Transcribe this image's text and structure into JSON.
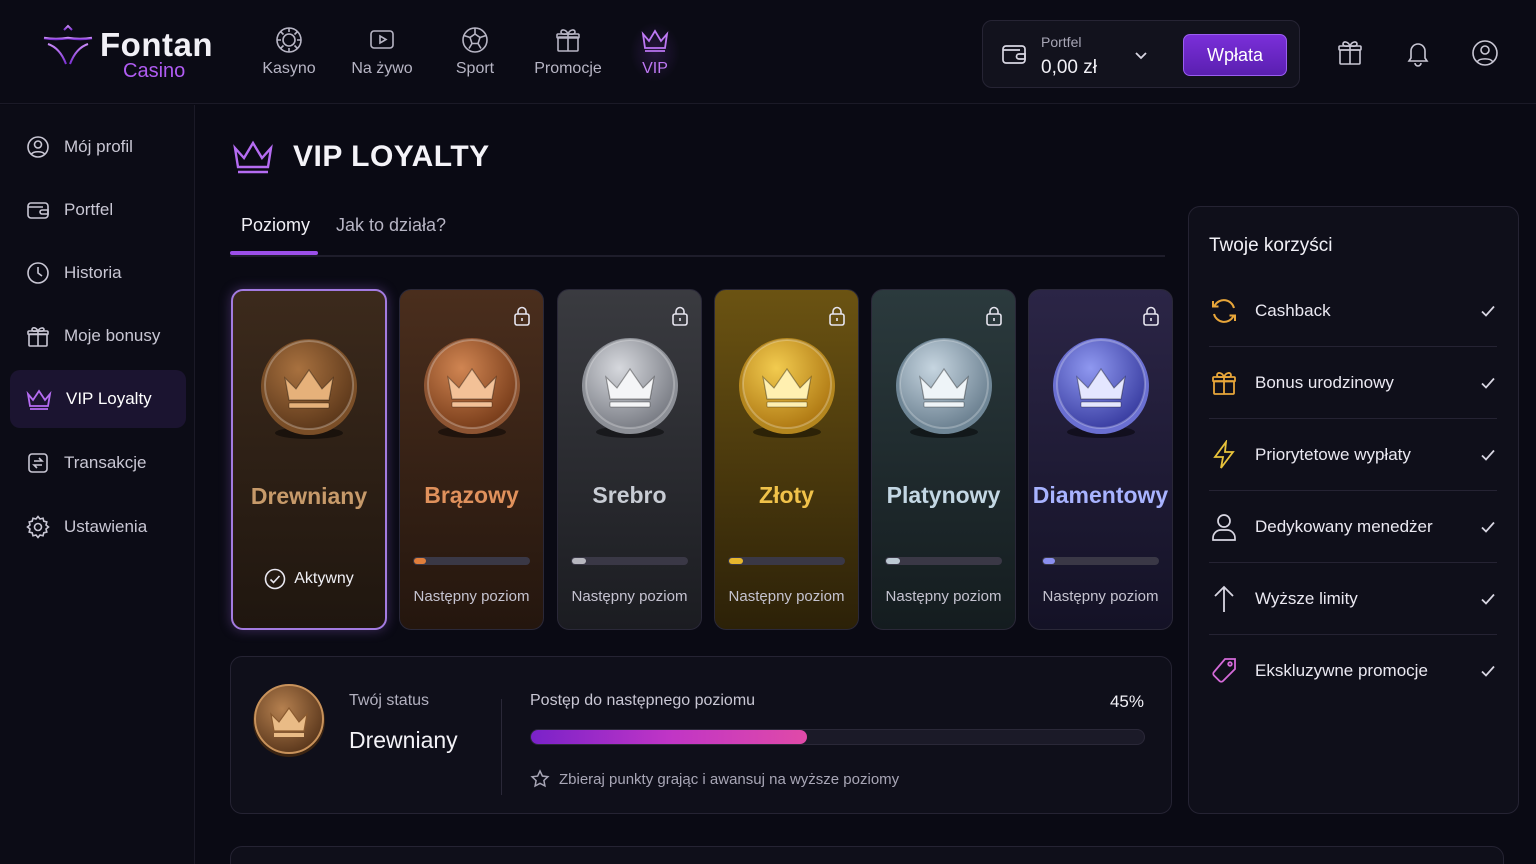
{
  "brand": {
    "name": "Fontan",
    "sub": "Casino",
    "accent": "#9b4fe8"
  },
  "nav": [
    {
      "label": "Kasyno",
      "icon": "casino-chip-icon"
    },
    {
      "label": "Na żywo",
      "icon": "live-play-icon"
    },
    {
      "label": "Sport",
      "icon": "football-icon"
    },
    {
      "label": "Promocje",
      "icon": "gift-icon"
    },
    {
      "label": "VIP",
      "icon": "crown-icon",
      "active": true
    }
  ],
  "wallet": {
    "label": "Portfel",
    "value": "0,00 zł",
    "deposit_label": "Wpłata"
  },
  "sidebar": {
    "items": [
      {
        "label": "Mój profil",
        "icon": "user-icon"
      },
      {
        "label": "Portfel",
        "icon": "wallet-icon"
      },
      {
        "label": "Historia",
        "icon": "clock-icon"
      },
      {
        "label": "Moje bonusy",
        "icon": "gift-icon"
      },
      {
        "label": "VIP Loyalty",
        "icon": "crown-icon",
        "active": true
      },
      {
        "label": "Transakcje",
        "icon": "transactions-icon"
      },
      {
        "label": "Ustawienia",
        "icon": "gear-icon"
      }
    ]
  },
  "page": {
    "title": "VIP LOYALTY"
  },
  "tabs": [
    {
      "label": "Poziomy",
      "active": true
    },
    {
      "label": "Jak to działa?"
    }
  ],
  "levels": [
    {
      "name": "Drewniany",
      "status": "Aktywny",
      "active": true,
      "locked": false,
      "color": "#c79a6a"
    },
    {
      "name": "Brązowy",
      "next": "Następny poziom",
      "locked": true,
      "progress": 0.1,
      "color": "#e0915c"
    },
    {
      "name": "Srebro",
      "next": "Następny poziom",
      "locked": true,
      "progress": 0.12,
      "color": "#c8ccd4"
    },
    {
      "name": "Złoty",
      "next": "Następny poziom",
      "locked": true,
      "progress": 0.12,
      "color": "#f0c24a"
    },
    {
      "name": "Platynowy",
      "next": "Następny poziom",
      "locked": true,
      "progress": 0.12,
      "color": "#c3d7e4"
    },
    {
      "name": "Diamentowy",
      "next": "Następny poziom",
      "locked": true,
      "progress": 0.1,
      "color": "#a8b3ff"
    }
  ],
  "status": {
    "label": "Twój status",
    "value": "Drewniany",
    "progress_label": "Postęp do następnego poziomu",
    "progress_pct": "45%",
    "progress": 0.45,
    "hint": "Zbieraj punkty grając i awansuj na wyższe poziomy"
  },
  "benefits": {
    "title": "Twoje korzyści",
    "items": [
      {
        "label": "Cashback",
        "icon": "cashback-icon"
      },
      {
        "label": "Bonus urodzinowy",
        "icon": "gift-icon"
      },
      {
        "label": "Priorytetowe wypłaty",
        "icon": "lightning-icon"
      },
      {
        "label": "Dedykowany menedżer",
        "icon": "user-icon"
      },
      {
        "label": "Wyższe limity",
        "icon": "arrow-up-icon"
      },
      {
        "label": "Ekskluzywne promocje",
        "icon": "tag-icon"
      }
    ]
  }
}
